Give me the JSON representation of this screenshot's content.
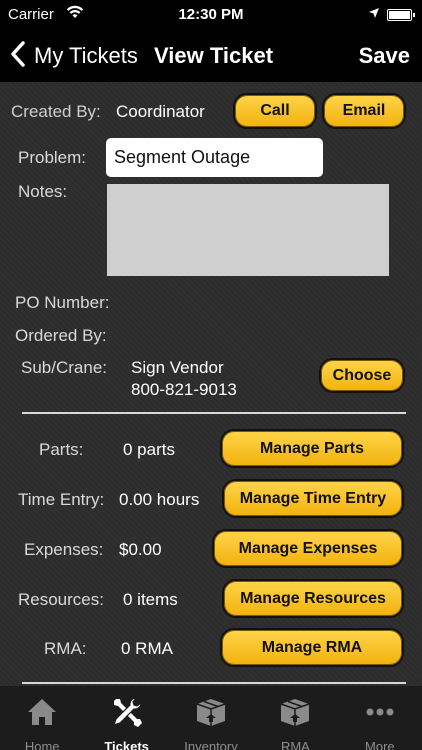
{
  "status_bar": {
    "carrier": "Carrier",
    "time": "12:30 PM"
  },
  "nav": {
    "back_label": "My Tickets",
    "title": "View Ticket",
    "save_label": "Save"
  },
  "ticket": {
    "created_by_label": "Created By:",
    "created_by_value": "Coordinator",
    "call_label": "Call",
    "email_label": "Email",
    "problem_label": "Problem:",
    "problem_value": "Segment Outage",
    "notes_label": "Notes:",
    "po_number_label": "PO Number:",
    "ordered_by_label": "Ordered By:",
    "sub_crane_label": "Sub/Crane:",
    "sub_crane_name": "Sign Vendor",
    "sub_crane_phone": "800-821-9013",
    "choose_label": "Choose"
  },
  "resources": [
    {
      "label": "Parts:",
      "value": "0 parts",
      "button": "Manage Parts"
    },
    {
      "label": "Time Entry:",
      "value": "0.00 hours",
      "button": "Manage Time Entry"
    },
    {
      "label": "Expenses:",
      "value": "$0.00",
      "button": "Manage Expenses"
    },
    {
      "label": "Resources:",
      "value": "0 items",
      "button": "Manage Resources"
    },
    {
      "label": "RMA:",
      "value": "0 RMA",
      "button": "Manage RMA"
    }
  ],
  "tabs": [
    {
      "label": "Home",
      "icon": "home-icon"
    },
    {
      "label": "Tickets",
      "icon": "tools-icon",
      "active": true
    },
    {
      "label": "Inventory",
      "icon": "box-icon"
    },
    {
      "label": "RMA",
      "icon": "box-icon"
    },
    {
      "label": "More",
      "icon": "more-icon"
    }
  ],
  "colors": {
    "accent": "#f7c22a",
    "background": "#2d2d2d",
    "bar": "#000000"
  }
}
